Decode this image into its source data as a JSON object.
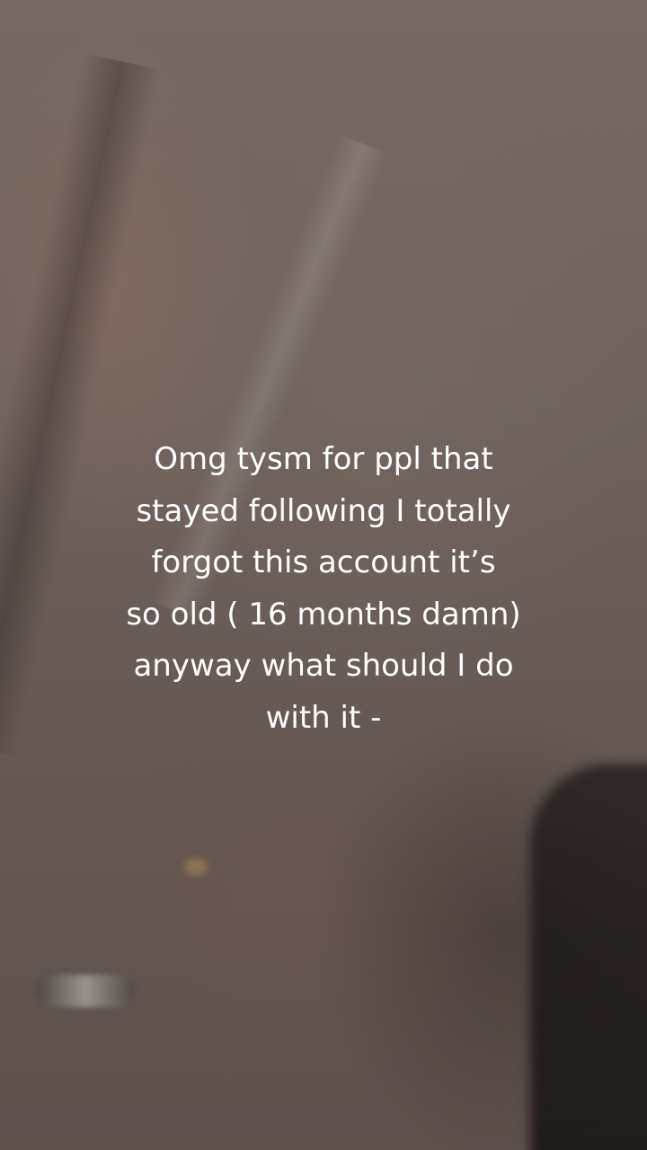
{
  "caption": {
    "lines": [
      "Omg tysm for ppl that",
      "stayed following I totally",
      "forgot this account it’s",
      "so old ( 16 months damn)",
      "anyway what should I do",
      "with it -"
    ]
  }
}
